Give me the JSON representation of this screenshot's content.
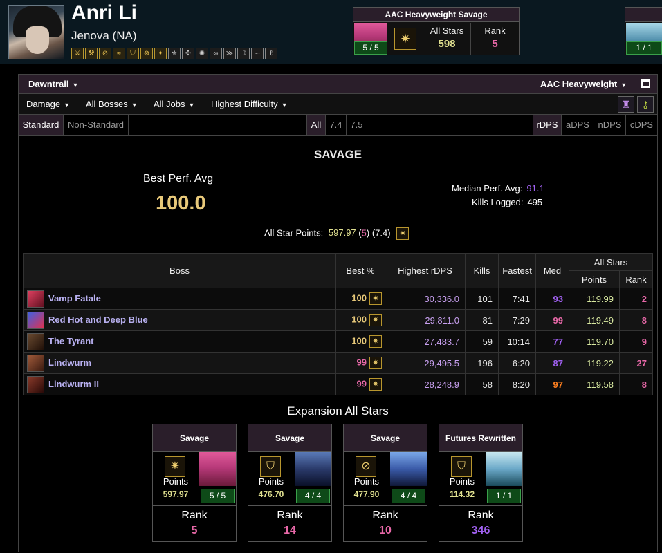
{
  "character": {
    "name": "Anri Li",
    "server": "Jenova (NA)",
    "job_icons": [
      "paladin-icon",
      "warrior-icon",
      "dark-knight-icon",
      "gunbreaker-icon",
      "whitemage-icon",
      "scholar-icon",
      "astrologian-icon",
      "sage-icon",
      "monk-icon",
      "dragoon-icon",
      "ninja-icon",
      "samurai-icon",
      "reaper-icon",
      "viper-icon",
      "bard-icon"
    ]
  },
  "header_card": {
    "title": "AAC Heavyweight Savage",
    "kills": "5 / 5",
    "all_stars_label": "All Stars",
    "all_stars_value": "598",
    "rank_label": "Rank",
    "rank_value": "5",
    "kills2": "1 / 1"
  },
  "filters": {
    "expansion": "Dawntrail",
    "zone": "AAC Heavyweight",
    "metric": "Damage",
    "bosses": "All Bosses",
    "jobs": "All Jobs",
    "difficulty": "Highest Difficulty"
  },
  "tabs": {
    "standard": "Standard",
    "non_standard": "Non-Standard",
    "patch_all": "All",
    "patch_74": "7.4",
    "patch_75": "7.5",
    "rdps": "rDPS",
    "adps": "aDPS",
    "ndps": "nDPS",
    "cdps": "cDPS"
  },
  "summary": {
    "section": "SAVAGE",
    "best_perf_label": "Best Perf. Avg",
    "best_perf_value": "100.0",
    "median_label": "Median Perf. Avg:",
    "median_value": "91.1",
    "kills_label": "Kills Logged:",
    "kills_value": "495",
    "asp_label": "All Star Points:",
    "asp_value": "597.97",
    "asp_open": "(",
    "asp_rank": "5",
    "asp_close": ")",
    "asp_patch": "(7.4)"
  },
  "table": {
    "headers": {
      "boss": "Boss",
      "best": "Best %",
      "rdps": "Highest rDPS",
      "kills": "Kills",
      "fastest": "Fastest",
      "med": "Med",
      "all_stars": "All Stars",
      "points": "Points",
      "rank": "Rank"
    },
    "rows": [
      {
        "boss": "Vamp Fatale",
        "best": "100",
        "rdps": "30,336.0",
        "kills": "101",
        "fastest": "7:41",
        "med": "93",
        "points": "119.99",
        "rank": "2"
      },
      {
        "boss": "Red Hot and Deep Blue",
        "best": "100",
        "rdps": "29,811.0",
        "kills": "81",
        "fastest": "7:29",
        "med": "99",
        "points": "119.49",
        "rank": "8"
      },
      {
        "boss": "The Tyrant",
        "best": "100",
        "rdps": "27,483.7",
        "kills": "59",
        "fastest": "10:14",
        "med": "77",
        "points": "119.70",
        "rank": "9"
      },
      {
        "boss": "Lindwurm",
        "best": "99",
        "rdps": "29,495.5",
        "kills": "196",
        "fastest": "6:20",
        "med": "87",
        "points": "119.22",
        "rank": "27"
      },
      {
        "boss": "Lindwurm II",
        "best": "99",
        "rdps": "28,248.9",
        "kills": "58",
        "fastest": "8:20",
        "med": "97",
        "points": "119.58",
        "rank": "8"
      }
    ]
  },
  "expansion": {
    "title": "Expansion All Stars",
    "cards": [
      {
        "title": "Savage",
        "points_label": "Points",
        "points": "597.97",
        "kills": "5 / 5",
        "rank_label": "Rank",
        "rank": "5"
      },
      {
        "title": "Savage",
        "points_label": "Points",
        "points": "476.70",
        "kills": "4 / 4",
        "rank_label": "Rank",
        "rank": "14"
      },
      {
        "title": "Savage",
        "points_label": "Points",
        "points": "477.90",
        "kills": "4 / 4",
        "rank_label": "Rank",
        "rank": "10"
      },
      {
        "title": "Futures Rewritten",
        "points_label": "Points",
        "points": "114.32",
        "kills": "1 / 1",
        "rank_label": "Rank",
        "rank": "346"
      }
    ]
  },
  "colors": {
    "gold": "#e8c97a",
    "pink": "#e868a8",
    "purple": "#a060f0",
    "orange": "#ff8020",
    "rdps": "#c8a0f0",
    "points": "#d8e8a0"
  }
}
